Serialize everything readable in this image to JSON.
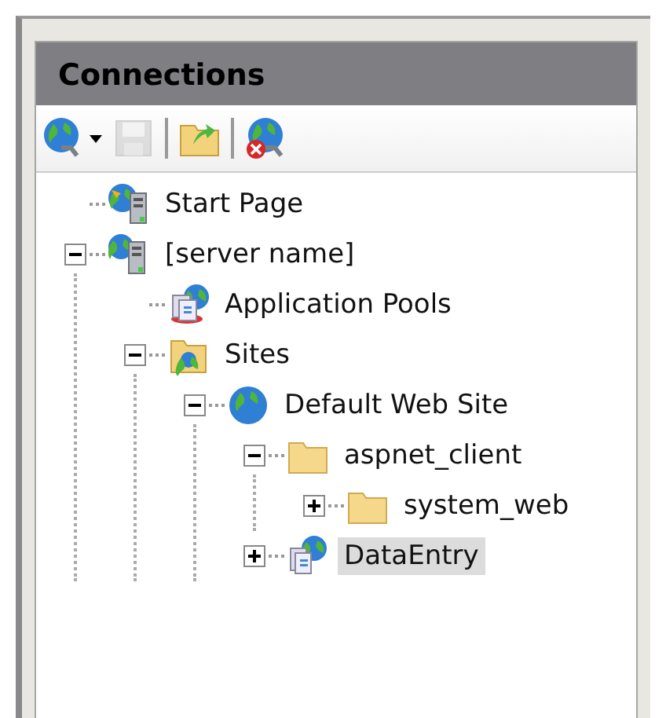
{
  "panel": {
    "title": "Connections"
  },
  "toolbar": [
    {
      "kind": "connect",
      "dropdown": true,
      "disabled": false
    },
    {
      "kind": "save",
      "dropdown": false,
      "disabled": true
    },
    {
      "kind": "separator"
    },
    {
      "kind": "up",
      "dropdown": false,
      "disabled": false
    },
    {
      "kind": "separator"
    },
    {
      "kind": "disconnect",
      "dropdown": false,
      "disabled": false
    }
  ],
  "tree": [
    {
      "label": "Start Page",
      "kind": "start",
      "selected": false
    },
    {
      "label": "[server name]",
      "kind": "server",
      "expanded": true,
      "selected": false,
      "children": [
        {
          "label": "Application Pools",
          "kind": "pools",
          "selected": false
        },
        {
          "label": "Sites",
          "kind": "sites",
          "expanded": true,
          "selected": false,
          "children": [
            {
              "label": "Default Web Site",
              "kind": "globe",
              "expanded": true,
              "selected": false,
              "children": [
                {
                  "label": "aspnet_client",
                  "kind": "folder",
                  "expanded": true,
                  "selected": false,
                  "children": [
                    {
                      "label": "system_web",
                      "kind": "folder",
                      "expanded": false,
                      "selected": false
                    }
                  ]
                },
                {
                  "label": "DataEntry",
                  "kind": "app",
                  "expanded": false,
                  "selected": true
                }
              ]
            }
          ]
        }
      ]
    }
  ]
}
